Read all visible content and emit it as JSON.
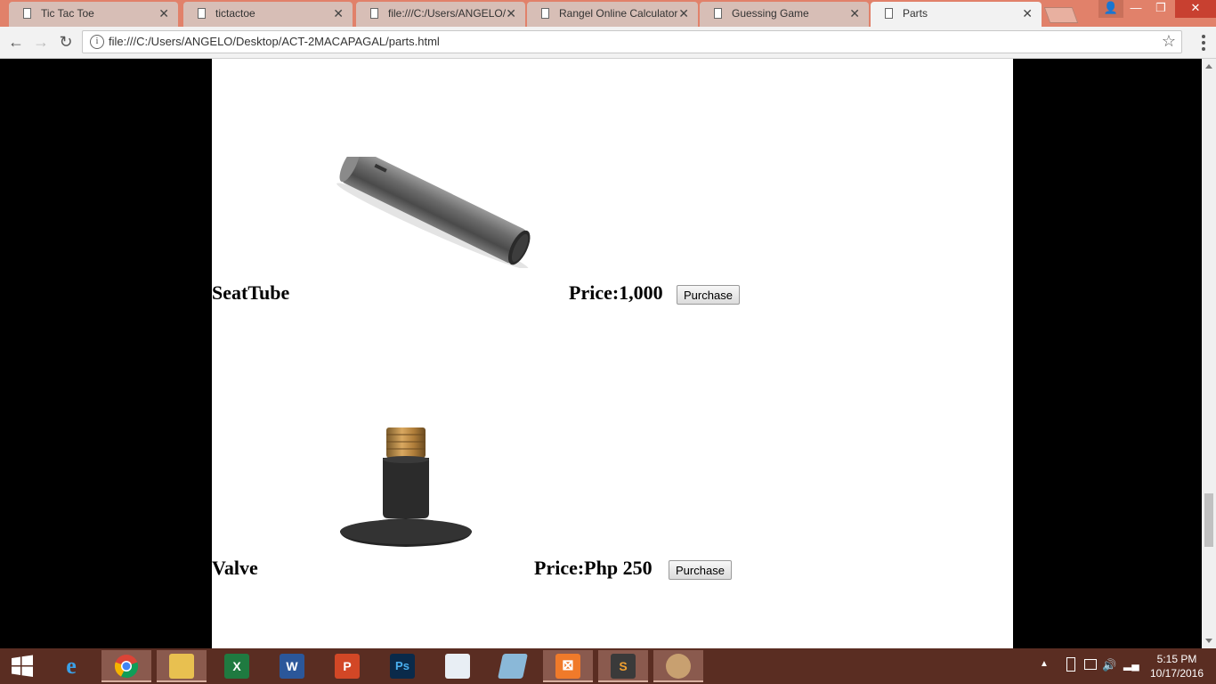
{
  "browser": {
    "tabs": [
      {
        "label": "Tic Tac Toe"
      },
      {
        "label": "tictactoe"
      },
      {
        "label": "file:///C:/Users/ANGELO/"
      },
      {
        "label": "Rangel Online Calculator"
      },
      {
        "label": "Guessing Game"
      },
      {
        "label": "Parts"
      }
    ],
    "url": "file:///C:/Users/ANGELO/Desktop/ACT-2MACAPAGAL/parts.html"
  },
  "parts": [
    {
      "name": "SeatTube",
      "price": "Price:1,000",
      "button": "Purchase"
    },
    {
      "name": "Valve",
      "price": "Price:Php 250",
      "button": "Purchase"
    }
  ],
  "taskbar": {
    "apps": [
      "start-icon",
      "ie-icon",
      "chrome-icon",
      "explorer-icon",
      "excel-icon",
      "word-icon",
      "powerpoint-icon",
      "photoshop-icon",
      "mysql-installer-icon",
      "notepad-icon",
      "xampp-icon",
      "sublime-icon",
      "paint-icon"
    ],
    "time": "5:15 PM",
    "date": "10/17/2016"
  },
  "colors": {
    "tabstrip": "#e1816a",
    "taskbar": "#5a2d22",
    "page_bg": "#ffffff",
    "outside_bg": "#000000"
  }
}
